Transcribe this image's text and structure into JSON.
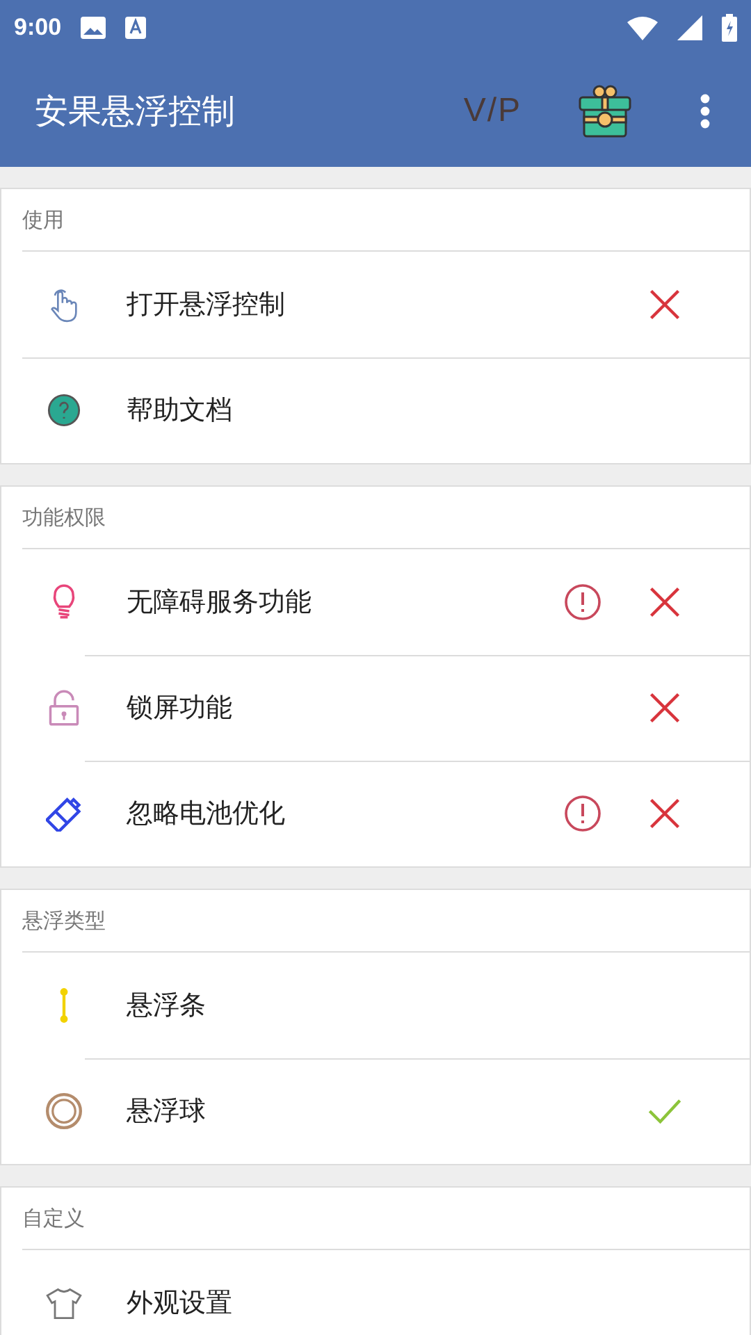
{
  "status_bar": {
    "time": "9:00"
  },
  "app_bar": {
    "title": "安果悬浮控制",
    "vip": "V/P"
  },
  "sections": [
    {
      "title": "使用",
      "items": [
        {
          "kind": "toggle",
          "label": "打开悬浮控制",
          "on": false
        },
        {
          "kind": "link",
          "label": "帮助文档"
        }
      ]
    },
    {
      "title": "功能权限",
      "items": [
        {
          "kind": "toggle",
          "label": "无障碍服务功能",
          "on": false,
          "warning": true
        },
        {
          "kind": "toggle",
          "label": "锁屏功能",
          "on": false,
          "warning": false
        },
        {
          "kind": "toggle",
          "label": "忽略电池优化",
          "on": false,
          "warning": true
        }
      ]
    },
    {
      "title": "悬浮类型",
      "items": [
        {
          "kind": "choice",
          "label": "悬浮条",
          "selected": false
        },
        {
          "kind": "choice",
          "label": "悬浮球",
          "selected": true
        }
      ]
    },
    {
      "title": "自定义",
      "items": [
        {
          "kind": "link",
          "label": "外观设置"
        }
      ]
    }
  ]
}
